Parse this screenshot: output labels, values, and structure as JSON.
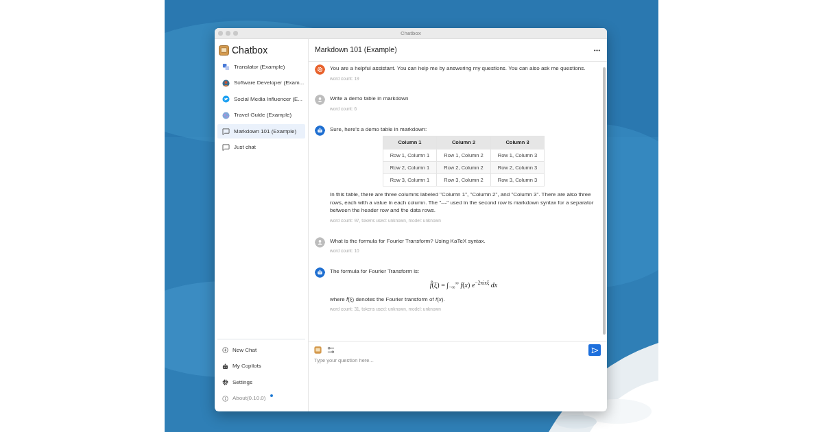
{
  "window": {
    "title": "Chatbox"
  },
  "sidebar": {
    "app_name": "Chatbox",
    "sessions": [
      {
        "label": "Translator (Example)",
        "kind": "copilot",
        "selected": false
      },
      {
        "label": "Software Developer (Exam...",
        "kind": "copilot",
        "selected": false
      },
      {
        "label": "Social Media Influencer (E...",
        "kind": "copilot",
        "selected": false
      },
      {
        "label": "Travel Guide (Example)",
        "kind": "copilot",
        "selected": false
      },
      {
        "label": "Markdown 101 (Example)",
        "kind": "chat",
        "selected": true
      },
      {
        "label": "Just chat",
        "kind": "chat",
        "selected": false
      }
    ],
    "menu": [
      {
        "label": "New Chat",
        "kind": "new",
        "notification": false
      },
      {
        "label": "My Copilots",
        "kind": "copilots",
        "notification": false
      },
      {
        "label": "Settings",
        "kind": "settings",
        "notification": false
      },
      {
        "label": "About(0.10.0)",
        "kind": "about",
        "notification": true
      }
    ]
  },
  "chat": {
    "session_title": "Markdown 101 (Example)",
    "messages": [
      {
        "kind": "system",
        "blocks": [
          {
            "kind": "text",
            "text": "You are a helpful assistant. You can help me by answering my questions. You can also ask me questions."
          }
        ],
        "meta": "word count: 19"
      },
      {
        "kind": "user",
        "blocks": [
          {
            "kind": "text",
            "text": "Write a demo table in markdown"
          }
        ],
        "meta": "word count: 6"
      },
      {
        "kind": "assistant",
        "blocks": [
          {
            "kind": "text",
            "text": "Sure, here's a demo table in markdown:"
          },
          {
            "kind": "table",
            "columns": [
              "Column 1",
              "Column 2",
              "Column 3"
            ],
            "rows": [
              [
                "Row 1, Column 1",
                "Row 1, Column 2",
                "Row 1, Column 3"
              ],
              [
                "Row 2, Column 1",
                "Row 2, Column 2",
                "Row 2, Column 3"
              ],
              [
                "Row 3, Column 1",
                "Row 3, Column 2",
                "Row 3, Column 3"
              ]
            ]
          },
          {
            "kind": "text",
            "text": "In this table, there are three columns labeled \"Column 1\", \"Column 2\", and \"Column 3\". There are also three rows, each with a value in each column. The \"---\" used in the second row is markdown syntax for a separator between the header row and the data rows."
          }
        ],
        "meta": "word count: 97, tokens used: unknown, model: unknown"
      },
      {
        "kind": "user",
        "blocks": [
          {
            "kind": "text",
            "text": "What is the formula for Fourier Transform? Using KaTeX syntax."
          }
        ],
        "meta": "word count: 10"
      },
      {
        "kind": "assistant",
        "blocks": [
          {
            "kind": "text",
            "text": "The formula for Fourier Transform is:"
          },
          {
            "kind": "formula",
            "text": "*f̂*(ξ) = ∫$_{−∞}$$^{∞}$ *f*(*x*) *e*$^{−2πixξ}$ *dx*"
          },
          {
            "kind": "text",
            "text": "where *f̂*(ξ) denotes the Fourier transform of *f*(*x*)."
          }
        ],
        "meta": "word count: 31, tokens used: unknown, model: unknown"
      }
    ],
    "input": {
      "placeholder": "Type your question here..."
    }
  }
}
